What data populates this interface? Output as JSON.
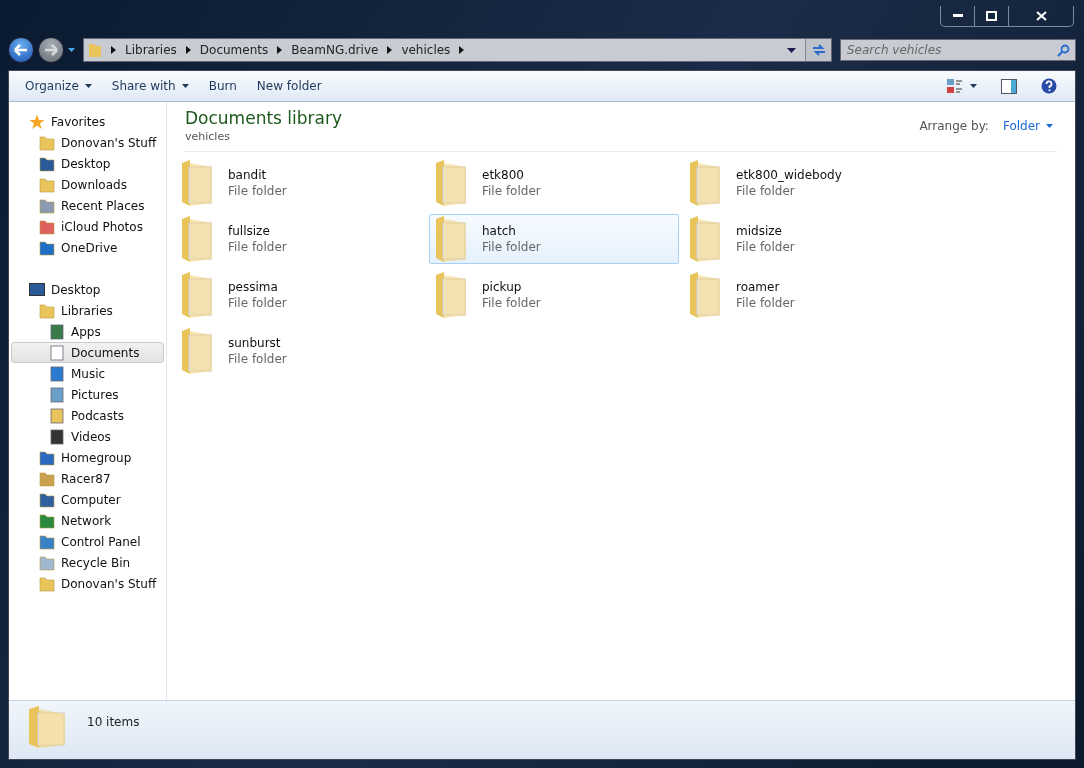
{
  "address": {
    "crumbs": [
      "Libraries",
      "Documents",
      "BeamNG.drive",
      "vehicles"
    ]
  },
  "search": {
    "placeholder": "Search vehicles"
  },
  "toolbar": {
    "buttons": [
      {
        "label": "Organize",
        "dropdown": true
      },
      {
        "label": "Share with",
        "dropdown": true
      },
      {
        "label": "Burn",
        "dropdown": false
      },
      {
        "label": "New folder",
        "dropdown": false
      }
    ]
  },
  "sidebar": {
    "groups": [
      {
        "label": "Favorites",
        "kind": "star",
        "selected": false,
        "children": [
          {
            "label": "Donovan's Stuff",
            "kind": "folder",
            "selected": false
          },
          {
            "label": "Desktop",
            "kind": "desktop",
            "selected": false
          },
          {
            "label": "Downloads",
            "kind": "downloads",
            "selected": false
          },
          {
            "label": "Recent Places",
            "kind": "recent",
            "selected": false
          },
          {
            "label": "iCloud Photos",
            "kind": "photos",
            "selected": false
          },
          {
            "label": "OneDrive",
            "kind": "cloud",
            "selected": false
          }
        ]
      },
      {
        "label": "Desktop",
        "kind": "desktop",
        "selected": false,
        "children": [
          {
            "label": "Libraries",
            "kind": "library",
            "selected": false,
            "children": [
              {
                "label": "Apps",
                "kind": "apps",
                "selected": false
              },
              {
                "label": "Documents",
                "kind": "document",
                "selected": true
              },
              {
                "label": "Music",
                "kind": "music",
                "selected": false
              },
              {
                "label": "Pictures",
                "kind": "pictures",
                "selected": false
              },
              {
                "label": "Podcasts",
                "kind": "folder",
                "selected": false
              },
              {
                "label": "Videos",
                "kind": "videos",
                "selected": false
              }
            ]
          },
          {
            "label": "Homegroup",
            "kind": "homegroup",
            "selected": false
          },
          {
            "label": "Racer87",
            "kind": "user",
            "selected": false
          },
          {
            "label": "Computer",
            "kind": "computer",
            "selected": false
          },
          {
            "label": "Network",
            "kind": "network",
            "selected": false
          },
          {
            "label": "Control Panel",
            "kind": "control",
            "selected": false
          },
          {
            "label": "Recycle Bin",
            "kind": "recycle",
            "selected": false
          },
          {
            "label": "Donovan's Stuff",
            "kind": "folder",
            "selected": false
          }
        ]
      }
    ]
  },
  "library": {
    "title": "Documents library",
    "subtitle": "vehicles",
    "arrange_label": "Arrange by:",
    "arrange_value": "Folder"
  },
  "items": [
    {
      "name": "bandit",
      "type": "File folder",
      "selected": false
    },
    {
      "name": "etk800",
      "type": "File folder",
      "selected": false
    },
    {
      "name": "etk800_widebody",
      "type": "File folder",
      "selected": false
    },
    {
      "name": "fullsize",
      "type": "File folder",
      "selected": false
    },
    {
      "name": "hatch",
      "type": "File folder",
      "selected": true
    },
    {
      "name": "midsize",
      "type": "File folder",
      "selected": false
    },
    {
      "name": "pessima",
      "type": "File folder",
      "selected": false
    },
    {
      "name": "pickup",
      "type": "File folder",
      "selected": false
    },
    {
      "name": "roamer",
      "type": "File folder",
      "selected": false
    },
    {
      "name": "sunburst",
      "type": "File folder",
      "selected": false
    }
  ],
  "status_bar": {
    "count": "10 items"
  }
}
